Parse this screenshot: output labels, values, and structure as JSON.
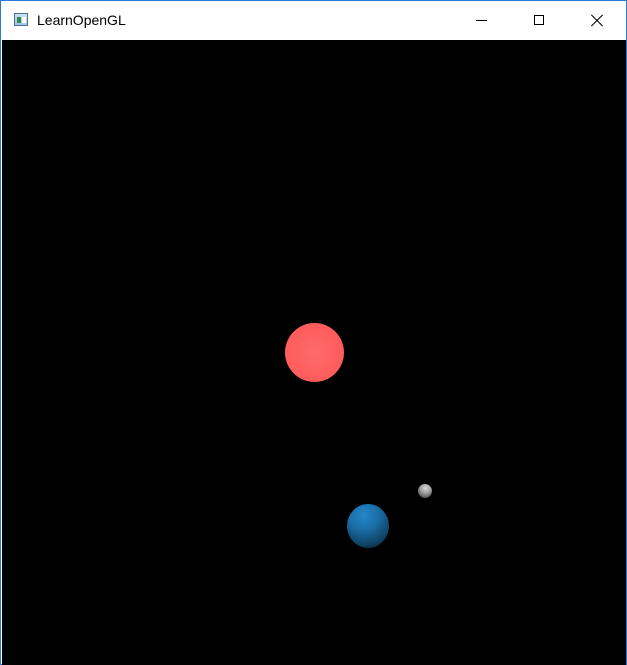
{
  "window": {
    "title": "LearnOpenGL",
    "icon": "app-window-icon",
    "controls": {
      "minimize_icon": "minimize-icon",
      "maximize_icon": "maximize-icon",
      "close_icon": "close-icon"
    }
  },
  "scene": {
    "background": "#000000",
    "objects": [
      {
        "name": "sun",
        "color": "#ff5c5c"
      },
      {
        "name": "planet",
        "color": "#1a6fa8"
      },
      {
        "name": "moon",
        "color": "#8a8a8a"
      }
    ]
  }
}
